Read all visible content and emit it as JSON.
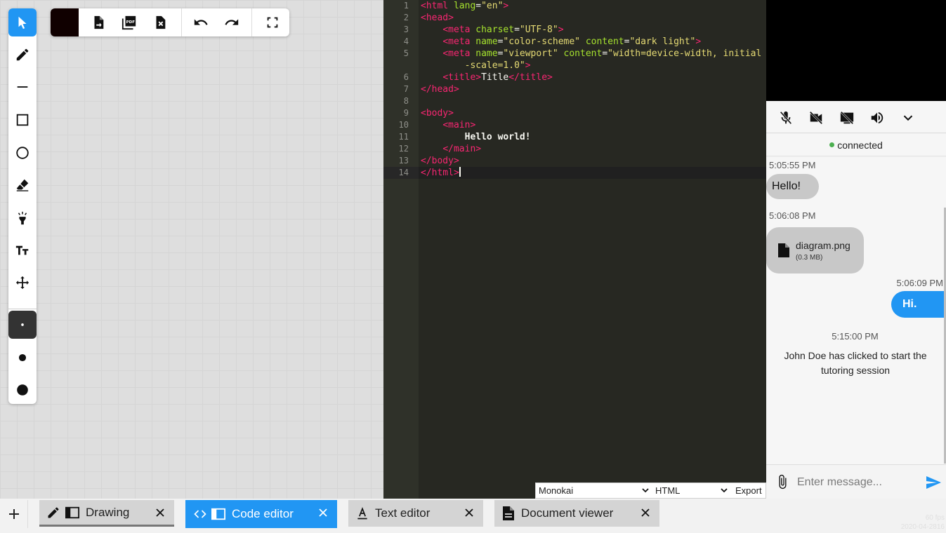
{
  "drawing": {
    "tools": [
      {
        "name": "select",
        "icon": "cursor-arrow-icon"
      },
      {
        "name": "pen",
        "icon": "pencil-icon"
      },
      {
        "name": "line",
        "icon": "line-icon"
      },
      {
        "name": "rectangle",
        "icon": "square-icon"
      },
      {
        "name": "circle",
        "icon": "circle-icon"
      },
      {
        "name": "eraser",
        "icon": "eraser-icon"
      },
      {
        "name": "highlighter",
        "icon": "highlighter-icon"
      },
      {
        "name": "text",
        "icon": "text-size-icon"
      },
      {
        "name": "move",
        "icon": "move-arrows-icon"
      }
    ],
    "brush_sizes": [
      "small",
      "medium",
      "large"
    ],
    "current_color": "#100000",
    "accent_color": "#2196f3"
  },
  "code_editor": {
    "line_numbers": [
      "1",
      "2",
      "3",
      "4",
      "5",
      "",
      "6",
      "7",
      "8",
      "9",
      "10",
      "11",
      "12",
      "13",
      "14"
    ],
    "lines": {
      "l1": [
        "<html",
        " lang",
        "=",
        "\"en\"",
        ">"
      ],
      "l2": [
        "<head>"
      ],
      "l3": [
        "    ",
        "<meta",
        " charset",
        "=",
        "\"UTF-8\"",
        ">"
      ],
      "l4": [
        "    ",
        "<meta",
        " name",
        "=",
        "\"color-scheme\"",
        " content",
        "=",
        "\"dark light\"",
        ">"
      ],
      "l5": [
        "    ",
        "<meta",
        " name",
        "=",
        "\"viewport\"",
        " content",
        "=",
        "\"width=device-width, initial"
      ],
      "l5b": [
        "        ",
        "-scale=1.0\"",
        ">"
      ],
      "l6": [
        "    ",
        "<title>",
        "Title",
        "</title>"
      ],
      "l7": [
        "</head>"
      ],
      "l9": [
        "<body>"
      ],
      "l10": [
        "    ",
        "<main>"
      ],
      "l11": [
        "        ",
        "Hello world!"
      ],
      "l12": [
        "    ",
        "</main>"
      ],
      "l13": [
        "</body>"
      ],
      "l14": [
        "</html>"
      ]
    },
    "theme": "Monokai",
    "language": "HTML",
    "export_label": "Export"
  },
  "call": {
    "status": "connected",
    "controls": [
      "mic-off-icon",
      "camera-off-icon",
      "screen-share-off-icon",
      "volume-icon",
      "chevron-down-icon"
    ]
  },
  "chat": {
    "messages": [
      {
        "time": "5:05:55 PM",
        "text": "Hello!",
        "from": "them"
      },
      {
        "time": "5:06:08 PM",
        "file": "diagram.png",
        "size": "(0.3 MB)",
        "from": "them"
      },
      {
        "time": "5:06:09 PM",
        "text": "Hi.",
        "from": "me"
      },
      {
        "time": "5:15:00 PM",
        "text": "John Doe has clicked to start the tutoring session",
        "from": "system"
      }
    ],
    "input_placeholder": "Enter message..."
  },
  "tabs": [
    {
      "label": "Drawing",
      "icon": "pencil-icon"
    },
    {
      "label": "Code editor",
      "icon": "code-icon"
    },
    {
      "label": "Text editor",
      "icon": "text-format-icon"
    },
    {
      "label": "Document viewer",
      "icon": "document-icon"
    }
  ],
  "footer": {
    "fps": "60 fps",
    "date": "2020-04-2816"
  }
}
